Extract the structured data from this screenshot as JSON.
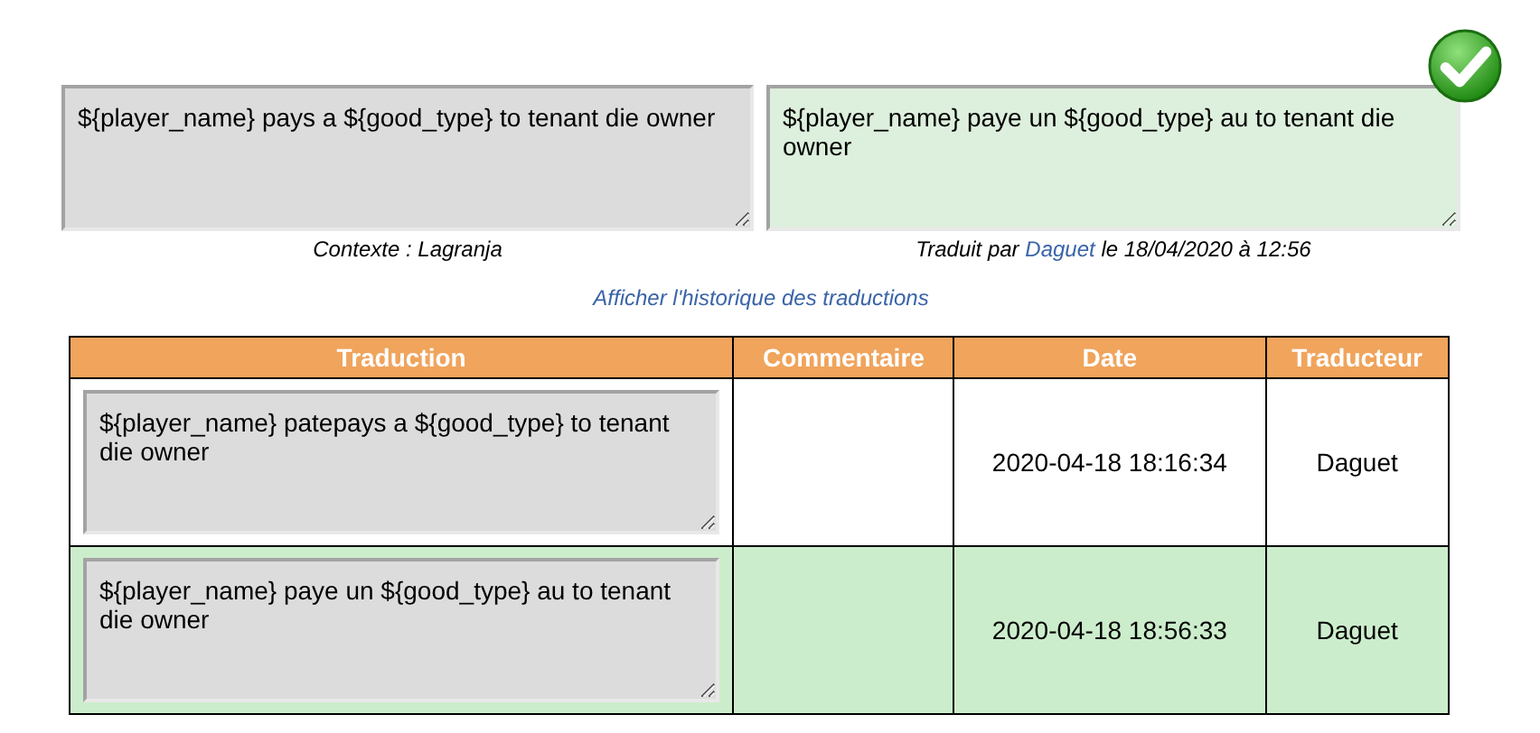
{
  "source": {
    "text": "${player_name} pays a ${good_type} to tenant die owner",
    "context": "Contexte : Lagranja"
  },
  "translation": {
    "text": "${player_name} paye un ${good_type} au to tenant die owner",
    "validated": true,
    "by_prefix": "Traduit par",
    "translator": "Daguet",
    "by_suffix": "le 18/04/2020 à 12:56"
  },
  "history_link": "Afficher l'historique des traductions",
  "table": {
    "columns": [
      "Traduction",
      "Commentaire",
      "Date",
      "Traducteur"
    ],
    "rows": [
      {
        "translation": "${player_name} patepays a ${good_type} to tenant die owner",
        "date": "2020-04-18 18:16:34",
        "translator": "Daguet",
        "selected": false
      },
      {
        "translation": "${player_name} paye un ${good_type} au to tenant die owner",
        "date": "2020-04-18 18:56:33",
        "translator": "Daguet",
        "selected": true
      }
    ]
  }
}
